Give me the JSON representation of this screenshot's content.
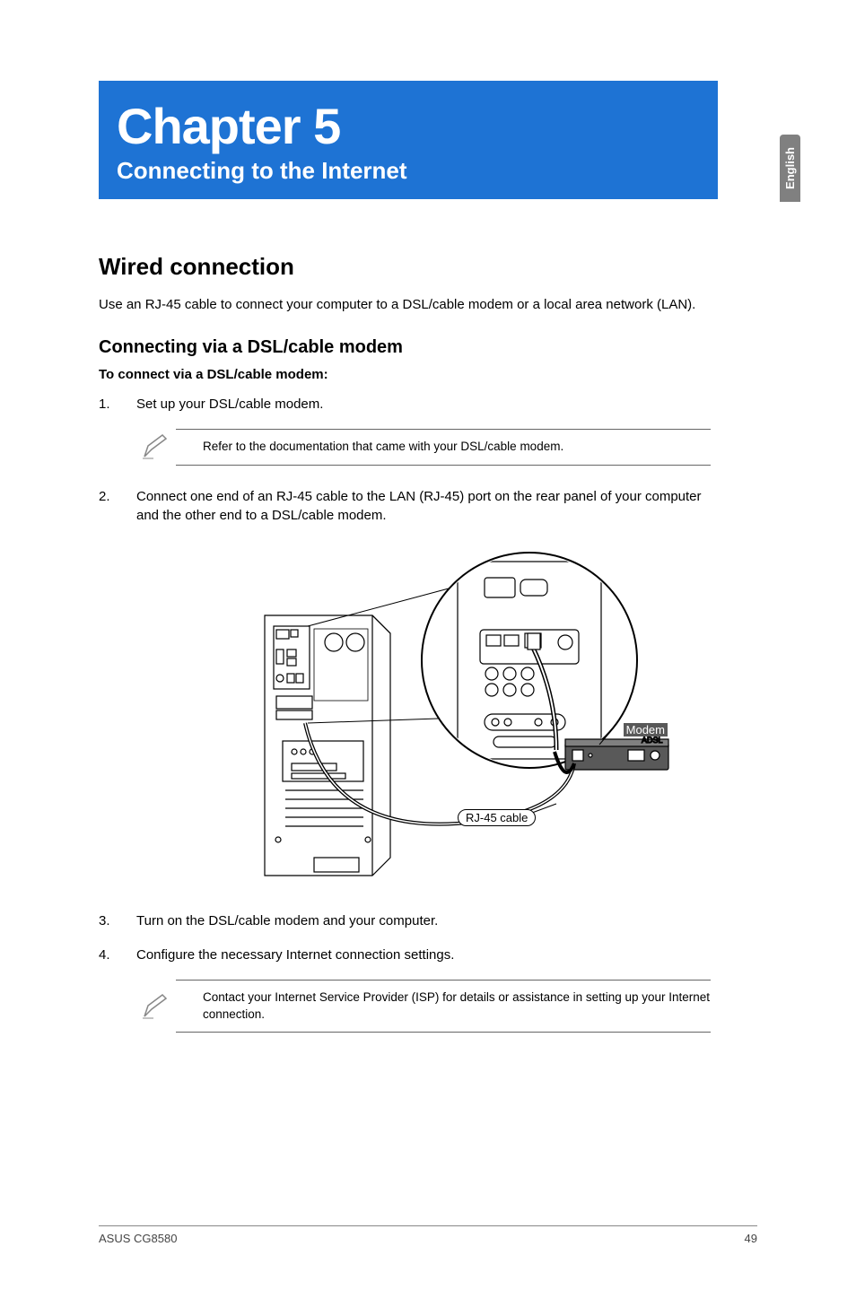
{
  "side_tab": "English",
  "chapter": {
    "title": "Chapter 5",
    "subtitle": "Connecting to the Internet"
  },
  "section1": {
    "heading": "Wired connection",
    "intro": "Use an RJ-45 cable to connect your computer to a DSL/cable modem or a local area network (LAN)."
  },
  "subsection": {
    "heading": "Connecting via a DSL/cable modem",
    "lead": "To connect via a DSL/cable modem:"
  },
  "steps": [
    {
      "num": "1.",
      "text": "Set up your DSL/cable modem."
    },
    {
      "num": "2.",
      "text": "Connect one end of an RJ-45 cable to the LAN (RJ-45) port on the rear panel of your computer and the other end to a DSL/cable modem."
    },
    {
      "num": "3.",
      "text": "Turn on the DSL/cable modem and your computer."
    },
    {
      "num": "4.",
      "text": "Configure the necessary Internet connection settings."
    }
  ],
  "notes": [
    "Refer to the documentation that came with your DSL/cable modem.",
    "Contact your Internet Service Provider (ISP) for details or assistance in setting up your Internet connection."
  ],
  "illustration_labels": {
    "modem": "Modem",
    "cable": "RJ-45 cable"
  },
  "footer": {
    "left": "ASUS CG8580",
    "right": "49"
  }
}
